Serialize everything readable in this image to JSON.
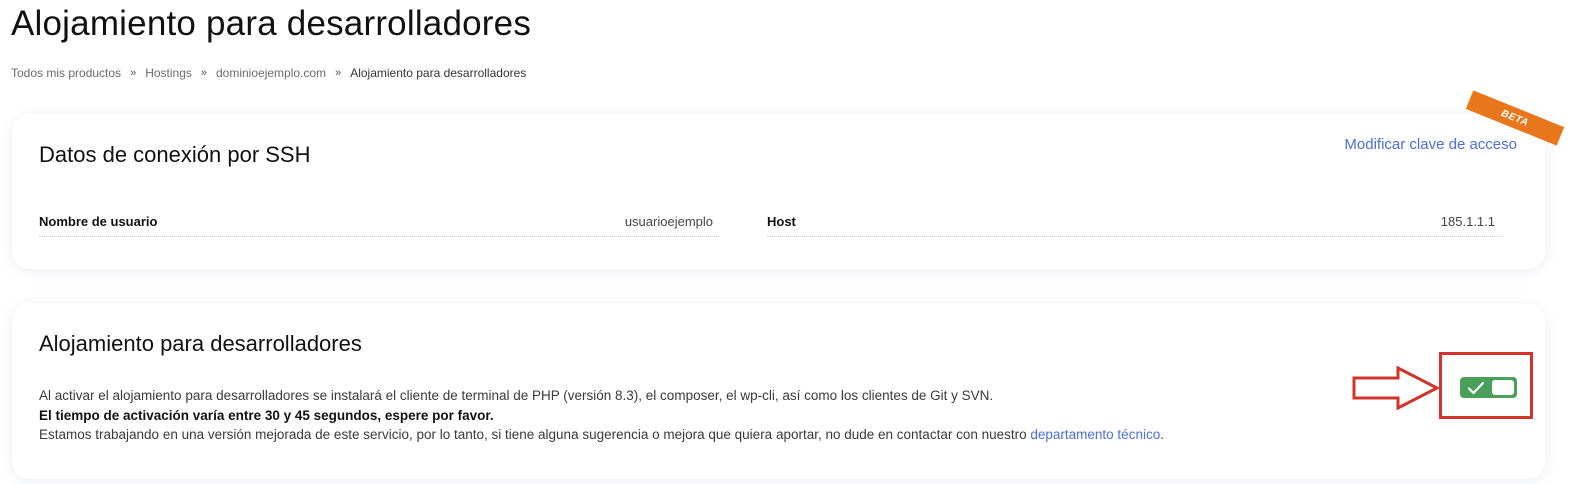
{
  "page": {
    "title": "Alojamiento para desarrolladores"
  },
  "breadcrumb": {
    "items": [
      "Todos mis productos",
      "Hostings",
      "dominioejemplo.com"
    ],
    "separator": "»",
    "current": "Alojamiento para desarrolladores"
  },
  "ssh_card": {
    "title": "Datos de conexión por SSH",
    "modify_link": "Modificar clave de acceso",
    "badge": "BETA",
    "username_label": "Nombre de usuario",
    "username_value": "usuarioejemplo",
    "host_label": "Host",
    "host_value": "185.1.1.1"
  },
  "dev_card": {
    "title": "Alojamiento para desarrolladores",
    "line1": "Al activar el alojamiento para desarrolladores se instalará el cliente de terminal de PHP (versión 8.3), el composer, el wp-cli, así como los clientes de Git y SVN.",
    "line2": "El tiempo de activación varía entre 30 y 45 segundos, espere por favor.",
    "line3_prefix": "Estamos trabajando en una versión mejorada de este servicio, por lo tanto, si tiene alguna sugerencia o mejora que quiera aportar, no dude en contactar con nuestro ",
    "line3_link": "departamento técnico",
    "line3_suffix": ".",
    "toggle_enabled": true
  },
  "colors": {
    "accent_link": "#4a6fdc",
    "beta_badge": "#e8761c",
    "toggle_on": "#49a05a",
    "highlight": "#d2332a"
  },
  "icons": {
    "toggle_check": "check-icon",
    "annotation_arrow": "arrow-right-icon"
  }
}
